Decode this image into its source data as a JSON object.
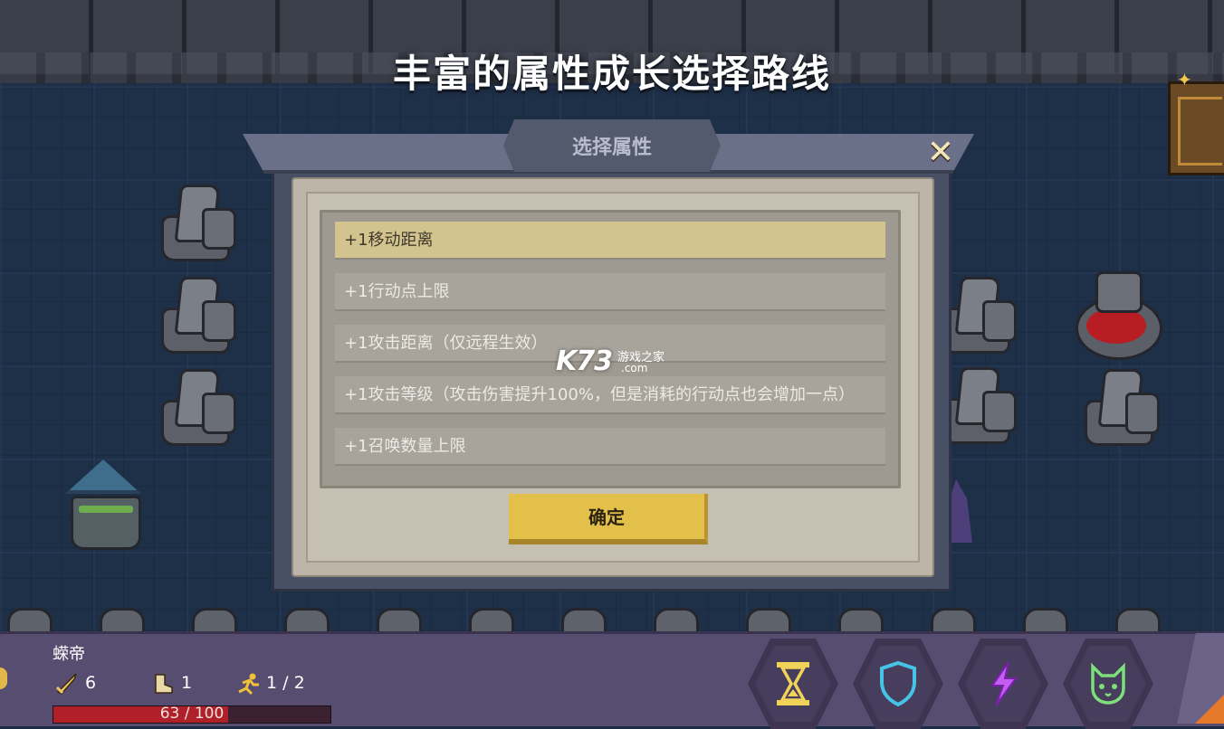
{
  "headline": "丰富的属性成长选择路线",
  "dialog": {
    "title": "选择属性",
    "close_icon": "close-x-icon",
    "options": [
      "+1移动距离",
      "+1行动点上限",
      "+1攻击距离（仅远程生效）",
      "+1攻击等级（攻击伤害提升100%，但是消耗的行动点也会增加一点）",
      "+1召唤数量上限"
    ],
    "selected_index": 0,
    "confirm_label": "确定"
  },
  "watermark": {
    "logo": "K73",
    "text": "游戏之家",
    "domain": ".com"
  },
  "hud": {
    "unit_name": "蝾帝",
    "attack": "6",
    "move": "1",
    "action_points": "1 / 2",
    "hp_text": "63 / 100",
    "hp_fraction": 0.63,
    "actions": [
      {
        "name": "wait",
        "icon": "hourglass-icon",
        "color": "#f2d35a"
      },
      {
        "name": "defend",
        "icon": "shield-icon",
        "color": "#46c3e6"
      },
      {
        "name": "skill",
        "icon": "lightning-icon",
        "color": "#b43ee8"
      },
      {
        "name": "summon",
        "icon": "cat-head-icon",
        "color": "#7ee07a"
      }
    ]
  },
  "colors": {
    "selected_option": "#d3c48f",
    "confirm_button": "#e2c049",
    "hp_fill": "#b02028",
    "hud_background": "#574d71"
  }
}
